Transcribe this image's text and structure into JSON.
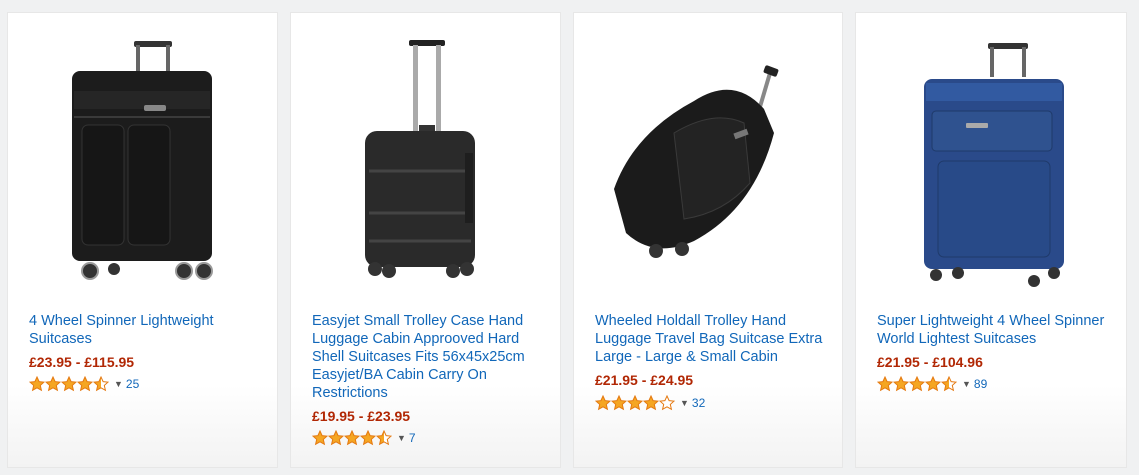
{
  "products": [
    {
      "title": "4 Wheel Spinner Lightweight Suitcases",
      "price": "£23.95 - £115.95",
      "rating": 4.5,
      "reviews": "25",
      "image_icon": "black-soft-spinner-suitcase"
    },
    {
      "title": "Easyjet Small Trolley Case Hand Luggage Cabin Approoved Hard Shell Suitcases Fits 56x45x25cm Easyjet/BA Cabin Carry On Restrictions",
      "price": "£19.95 - £23.95",
      "rating": 4.5,
      "reviews": "7",
      "image_icon": "black-hard-shell-cabin-case"
    },
    {
      "title": "Wheeled Holdall Trolley Hand Luggage Travel Bag Suitcase Extra Large - Large & Small Cabin",
      "price": "£21.95 - £24.95",
      "rating": 4.0,
      "reviews": "32",
      "image_icon": "black-wheeled-holdall-bag"
    },
    {
      "title": "Super Lightweight 4 Wheel Spinner World Lightest Suitcases",
      "price": "£21.95 - £104.96",
      "rating": 4.5,
      "reviews": "89",
      "image_icon": "blue-soft-spinner-suitcase"
    }
  ],
  "colors": {
    "link": "#1167b9",
    "price": "#b12704",
    "star_fill": "#f5a623",
    "star_outline": "#e47911"
  }
}
